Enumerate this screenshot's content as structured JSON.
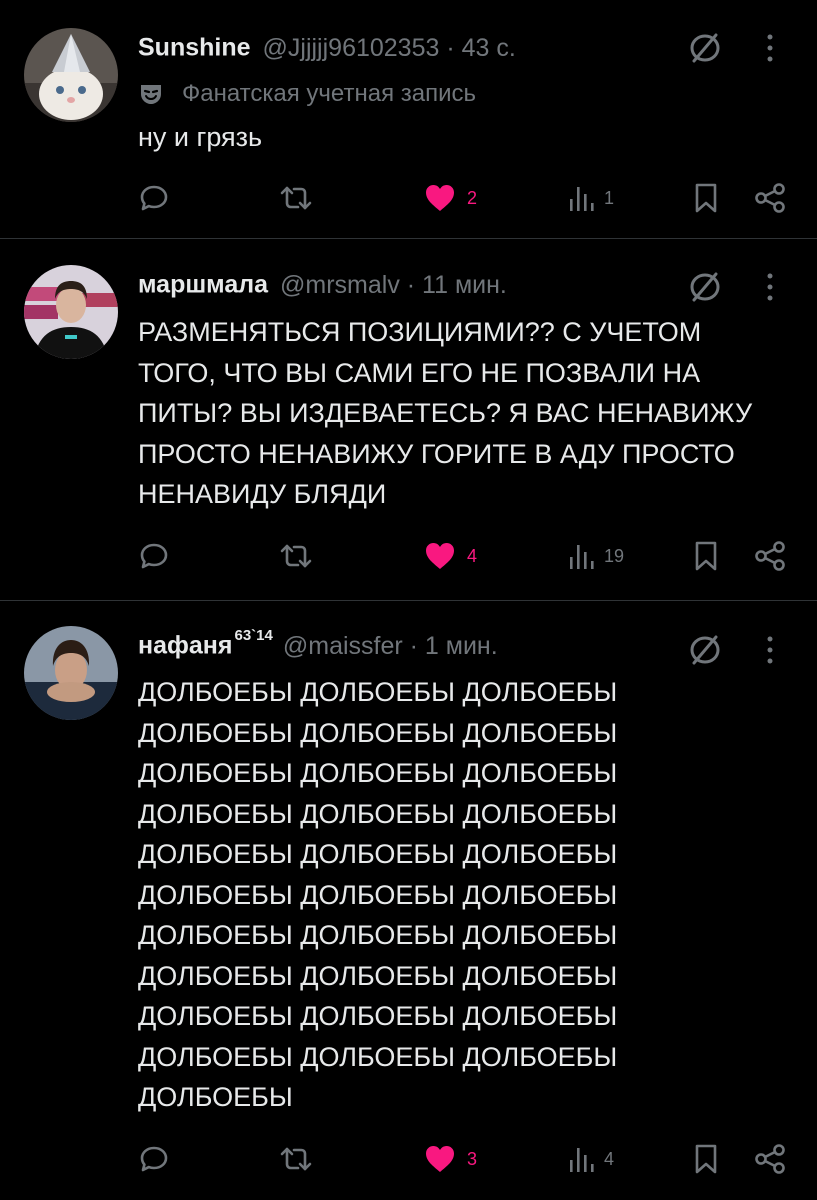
{
  "posts": [
    {
      "name": "Sunshine",
      "name_sup": "",
      "handle": "@Jjjjjj96102353 · 43 с.",
      "fan_label": "Фанатская учетная запись",
      "text": "ну и грязь",
      "stats": {
        "replies": "",
        "reposts": "",
        "likes": "2",
        "views": "1"
      },
      "liked": true
    },
    {
      "name": "маршмала",
      "name_sup": "",
      "handle": "@mrsmalv · 11 мин.",
      "fan_label": "",
      "text": "РАЗМЕНЯТЬСЯ ПОЗИЦИЯМИ?? С УЧЕТОМ\nТОГО, ЧТО ВЫ САМИ ЕГО НЕ ПОЗВАЛИ НА\nПИТЫ? ВЫ ИЗДЕВАЕТЕСЬ? Я ВАС НЕНАВИЖУ\nПРОСТО НЕНАВИЖУ ГОРИТЕ В АДУ ПРОСТО\nНЕНАВИДУ БЛЯДИ",
      "stats": {
        "replies": "",
        "reposts": "",
        "likes": "4",
        "views": "19"
      },
      "liked": true
    },
    {
      "name": "нафаня",
      "name_sup": "63`14",
      "handle": "@maissfer · 1 мин.",
      "fan_label": "",
      "text": "ДОЛБОЕБЫ ДОЛБОЕБЫ ДОЛБОЕБЫ\nДОЛБОЕБЫ ДОЛБОЕБЫ ДОЛБОЕБЫ\nДОЛБОЕБЫ ДОЛБОЕБЫ ДОЛБОЕБЫ\nДОЛБОЕБЫ ДОЛБОЕБЫ ДОЛБОЕБЫ\nДОЛБОЕБЫ ДОЛБОЕБЫ ДОЛБОЕБЫ\nДОЛБОЕБЫ ДОЛБОЕБЫ ДОЛБОЕБЫ\nДОЛБОЕБЫ ДОЛБОЕБЫ ДОЛБОЕБЫ\nДОЛБОЕБЫ ДОЛБОЕБЫ ДОЛБОЕБЫ\nДОЛБОЕБЫ ДОЛБОЕБЫ ДОЛБОЕБЫ\nДОЛБОЕБЫ ДОЛБОЕБЫ ДОЛБОЕБЫ\nДОЛБОЕБЫ",
      "stats": {
        "replies": "",
        "reposts": "",
        "likes": "3",
        "views": "4"
      },
      "liked": true
    }
  ],
  "icons": {
    "reply": "reply-icon",
    "repost": "repost-icon",
    "like": "heart-filled-icon",
    "views": "views-icon",
    "bookmark": "bookmark-icon",
    "share": "share-icon",
    "ghost": "ghost-slash-icon",
    "more": "more-vertical-icon",
    "fan": "mask-icon"
  },
  "colors": {
    "background": "#000000",
    "text": "#e7e9ea",
    "muted": "#71767b",
    "like": "#f91880",
    "divider": "#2f3336"
  }
}
